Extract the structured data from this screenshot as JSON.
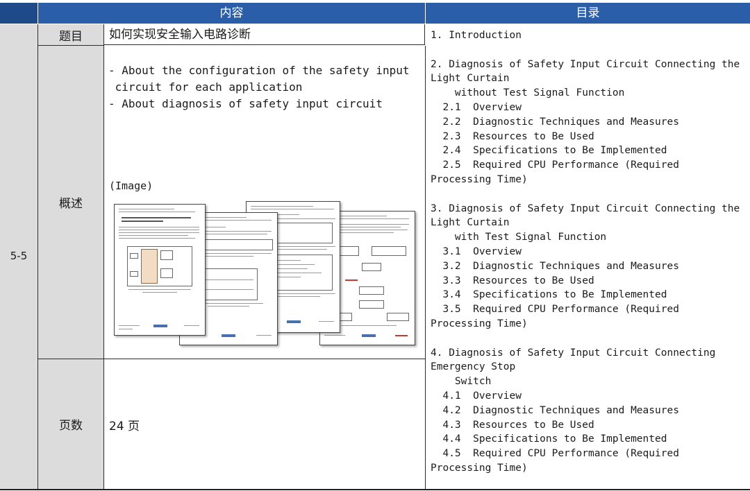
{
  "header": {
    "content": "内容",
    "toc": "目录"
  },
  "row_id": "5-5",
  "rows": {
    "title_label": "题目",
    "title_value": "如何实现安全输入电路诊断",
    "summary_label": "概述",
    "summary_text": "- About the configuration of the safety input\n circuit for each application\n- About diagnosis of safety input circuit",
    "image_label": "(Image)",
    "pages_label": "页数",
    "pages_value": "24 页"
  },
  "toc": [
    "1. Introduction",
    "",
    "2. Diagnosis of Safety Input Circuit Connecting the",
    "Light Curtain",
    "    without Test Signal Function",
    "  2.1  Overview",
    "  2.2  Diagnostic Techniques and Measures",
    "  2.3  Resources to Be Used",
    "  2.4  Specifications to Be Implemented",
    "  2.5  Required CPU Performance (Required",
    "Processing Time)",
    "",
    "3. Diagnosis of Safety Input Circuit Connecting the",
    "Light Curtain",
    "    with Test Signal Function",
    "  3.1  Overview",
    "  3.2  Diagnostic Techniques and Measures",
    "  3.3  Resources to Be Used",
    "  3.4  Specifications to Be Implemented",
    "  3.5  Required CPU Performance (Required",
    "Processing Time)",
    "",
    "4. Diagnosis of Safety Input Circuit Connecting",
    "Emergency Stop",
    "    Switch",
    "  4.1  Overview",
    "  4.2  Diagnostic Techniques and Measures",
    "  4.3  Resources to Be Used",
    "  4.4  Specifications to Be Implemented",
    "  4.5  Required CPU Performance (Required",
    "Processing Time)"
  ],
  "colors": {
    "header_blue": "#2b5ea8",
    "label_gray": "#dcdcdc"
  }
}
